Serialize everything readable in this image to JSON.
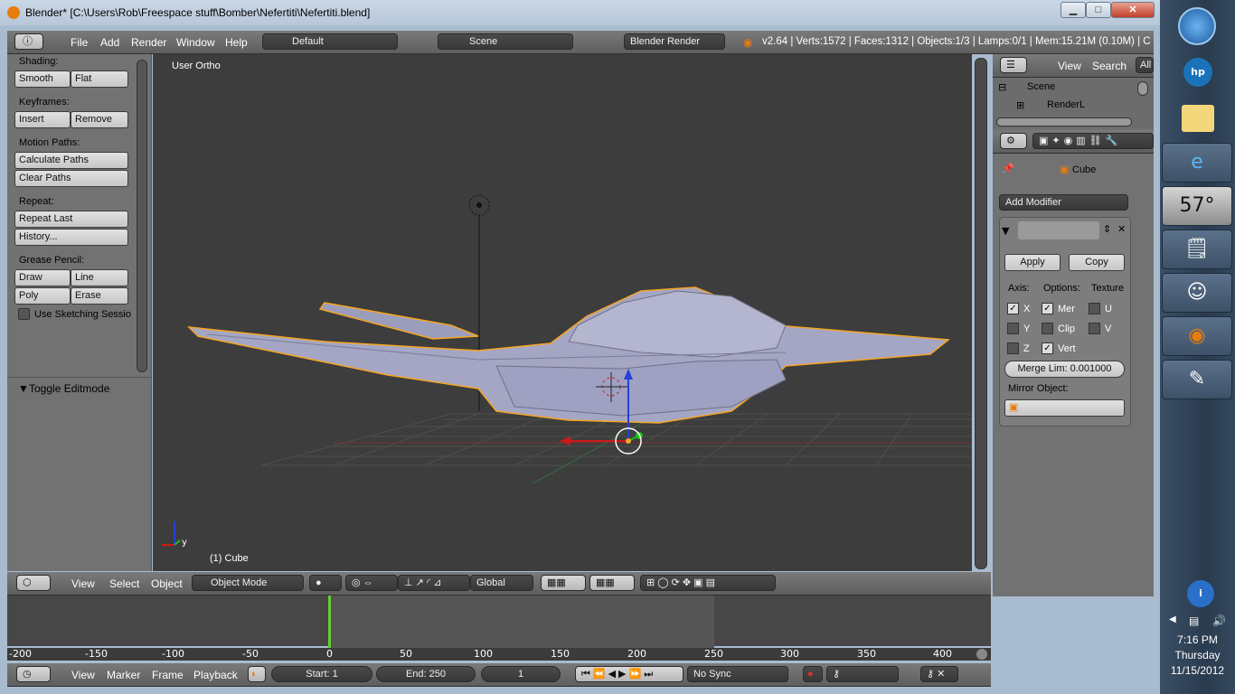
{
  "window": {
    "title": "Blender* [C:\\Users\\Rob\\Freespace stuff\\Bomber\\Nefertiti\\Nefertiti.blend]",
    "min": "▁",
    "max": "□",
    "close": "✕"
  },
  "topbar": {
    "menus": [
      "File",
      "Add",
      "Render",
      "Window",
      "Help"
    ],
    "layout": "Default",
    "scene": "Scene",
    "engine": "Blender Render",
    "stats": "v2.64 | Verts:1572 | Faces:1312 | Objects:1/3 | Lamps:0/1 | Mem:15.21M (0.10M) | C"
  },
  "tools": {
    "shading_label": "Shading:",
    "smooth": "Smooth",
    "flat": "Flat",
    "keyframes_label": "Keyframes:",
    "insert": "Insert",
    "remove": "Remove",
    "motion_label": "Motion Paths:",
    "calc_paths": "Calculate Paths",
    "clear_paths": "Clear Paths",
    "repeat_label": "Repeat:",
    "repeat_last": "Repeat Last",
    "history": "History...",
    "grease_label": "Grease Pencil:",
    "draw": "Draw",
    "line": "Line",
    "poly": "Poly",
    "erase": "Erase",
    "sketch": "Use Sketching Sessio",
    "toggle_edit": "Toggle Editmode"
  },
  "viewport": {
    "view_name": "User Ortho",
    "object_label": "(1) Cube",
    "axis_y": "y"
  },
  "view3d_header": {
    "view": "View",
    "select": "Select",
    "object": "Object",
    "mode": "Object Mode",
    "orientation": "Global"
  },
  "outliner": {
    "view": "View",
    "search": "Search",
    "all": "All",
    "scene": "Scene",
    "render_layer": "RenderL"
  },
  "properties": {
    "breadcrumb": "Cube",
    "add_modifier": "Add Modifier",
    "apply": "Apply",
    "copy": "Copy",
    "axis_label": "Axis:",
    "options_label": "Options:",
    "texture_label": "Texture",
    "x": "X",
    "y": "Y",
    "z": "Z",
    "merge": "Mer",
    "clip": "Clip",
    "vert": "Vert",
    "u": "U",
    "v": "V",
    "merge_limit": "Merge Lim: 0.001000",
    "mirror_object": "Mirror Object:"
  },
  "timeline": {
    "ticks": [
      "-200",
      "-150",
      "-100",
      "-50",
      "0",
      "50",
      "100",
      "150",
      "200",
      "250",
      "300",
      "350",
      "400"
    ],
    "view": "View",
    "marker": "Marker",
    "frame": "Frame",
    "playback": "Playback",
    "start": "Start: 1",
    "end": "End: 250",
    "current": "1",
    "sync": "No Sync"
  },
  "taskbar": {
    "weather": "57°",
    "time": "7:16 PM",
    "day": "Thursday",
    "date": "11/15/2012"
  },
  "colors": {
    "accent": "#e87d0d",
    "selection": "#f5a623",
    "active_blue": "#5680c2"
  }
}
